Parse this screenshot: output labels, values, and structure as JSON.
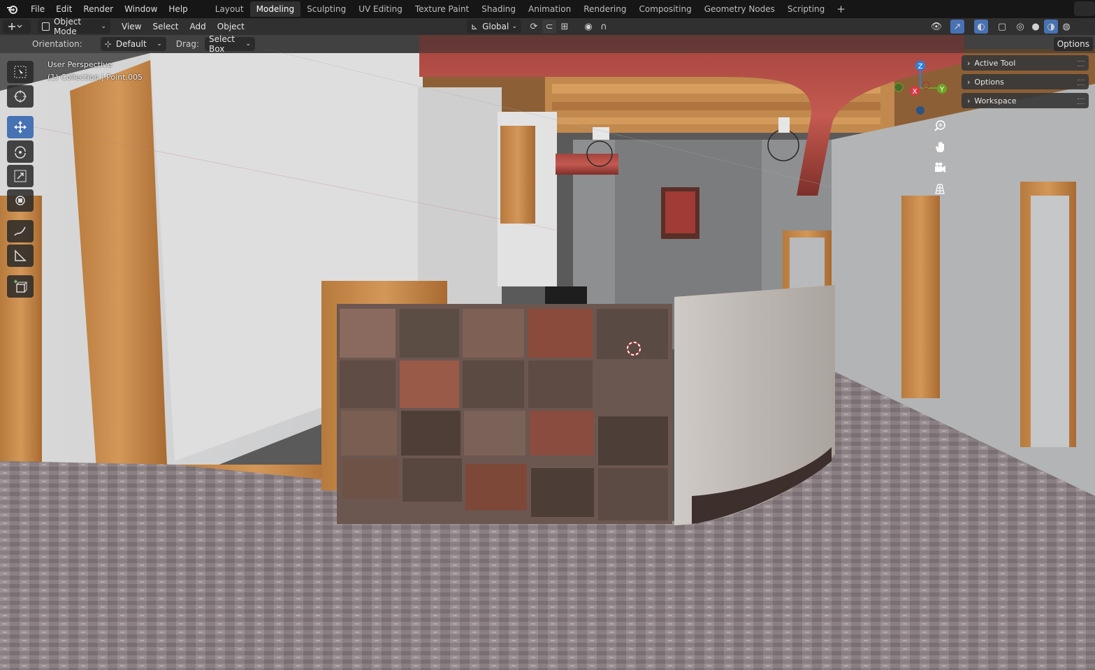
{
  "topbar": {
    "menus": [
      "File",
      "Edit",
      "Render",
      "Window",
      "Help"
    ],
    "workspaces": [
      "Layout",
      "Modeling",
      "Sculpting",
      "UV Editing",
      "Texture Paint",
      "Shading",
      "Animation",
      "Rendering",
      "Compositing",
      "Geometry Nodes",
      "Scripting"
    ],
    "active_workspace": "Modeling",
    "add_workspace": "+"
  },
  "header": {
    "mode": "Object Mode",
    "menus": [
      "View",
      "Select",
      "Add",
      "Object"
    ],
    "transform_orientation": "Global"
  },
  "tool_header": {
    "orientation_label": "Orientation:",
    "orientation_value": "Default",
    "drag_label": "Drag:",
    "drag_value": "Select Box",
    "options": "Options"
  },
  "viewport": {
    "perspective": "User Perspective",
    "collection_info": "(1) Collection | Point.005"
  },
  "tools": [
    "select-box",
    "cursor",
    "move",
    "rotate",
    "scale",
    "transform",
    "annotate",
    "measure",
    "add-cube"
  ],
  "active_tool": "move",
  "npanel": {
    "items": [
      "Active Tool",
      "Options",
      "Workspace"
    ]
  },
  "gizmo": {
    "x": "X",
    "y": "Y",
    "z": "Z"
  },
  "colors": {
    "accent": "#4772b3",
    "axis_x": "#d63a45",
    "axis_y": "#6ea425",
    "axis_z": "#2f7fd8"
  }
}
